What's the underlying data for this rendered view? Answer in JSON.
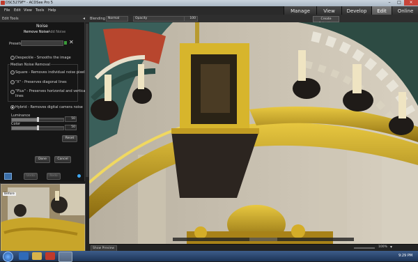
{
  "window": {
    "title": "DSC5279F* - ACDSee Pro 5"
  },
  "menu": [
    "File",
    "Edit",
    "View",
    "Tools",
    "Help"
  ],
  "modes": [
    {
      "label": "Manage",
      "active": false
    },
    {
      "label": "View",
      "active": false
    },
    {
      "label": "Develop",
      "active": false
    },
    {
      "label": "Edit",
      "active": true
    },
    {
      "label": "Online",
      "active": false
    }
  ],
  "toolbar": {
    "left_label": "Edit Tools",
    "blending_label": "Blending",
    "blending_value": "Normal",
    "opacity_label": "Opacity",
    "opacity_value": "100",
    "create_selection": "Create Selection"
  },
  "panel": {
    "title": "Noise",
    "subtabs": [
      "Remove Noise",
      "Add Noise"
    ],
    "presets_label": "Presets",
    "despeckle": "Despeckle - Smooths the image",
    "group_title": "Median Noise Removal",
    "median_options": [
      "Square - Removes individual noise pixels",
      "\"X\" - Preserves diagonal lines",
      "\"Plus\" - Preserves horizontal and vertical",
      "lines"
    ],
    "hybrid": "Hybrid - Removes digital camera noise",
    "sliders": [
      {
        "label": "Luminance",
        "value": "50"
      },
      {
        "label": "Color",
        "value": "50"
      }
    ],
    "reset": "Reset",
    "done": "Done",
    "cancel": "Cancel",
    "undo": "Undo",
    "redo": "Redo"
  },
  "navigator": {
    "label": "Before"
  },
  "status": {
    "left": "Show Preview",
    "zoom": "100%"
  },
  "taskbar": {
    "time": "9:29 PM"
  },
  "colors": {
    "accent_active": "#6a6a6a",
    "gold": "#c9a227",
    "marble": "#d9d3c4"
  }
}
